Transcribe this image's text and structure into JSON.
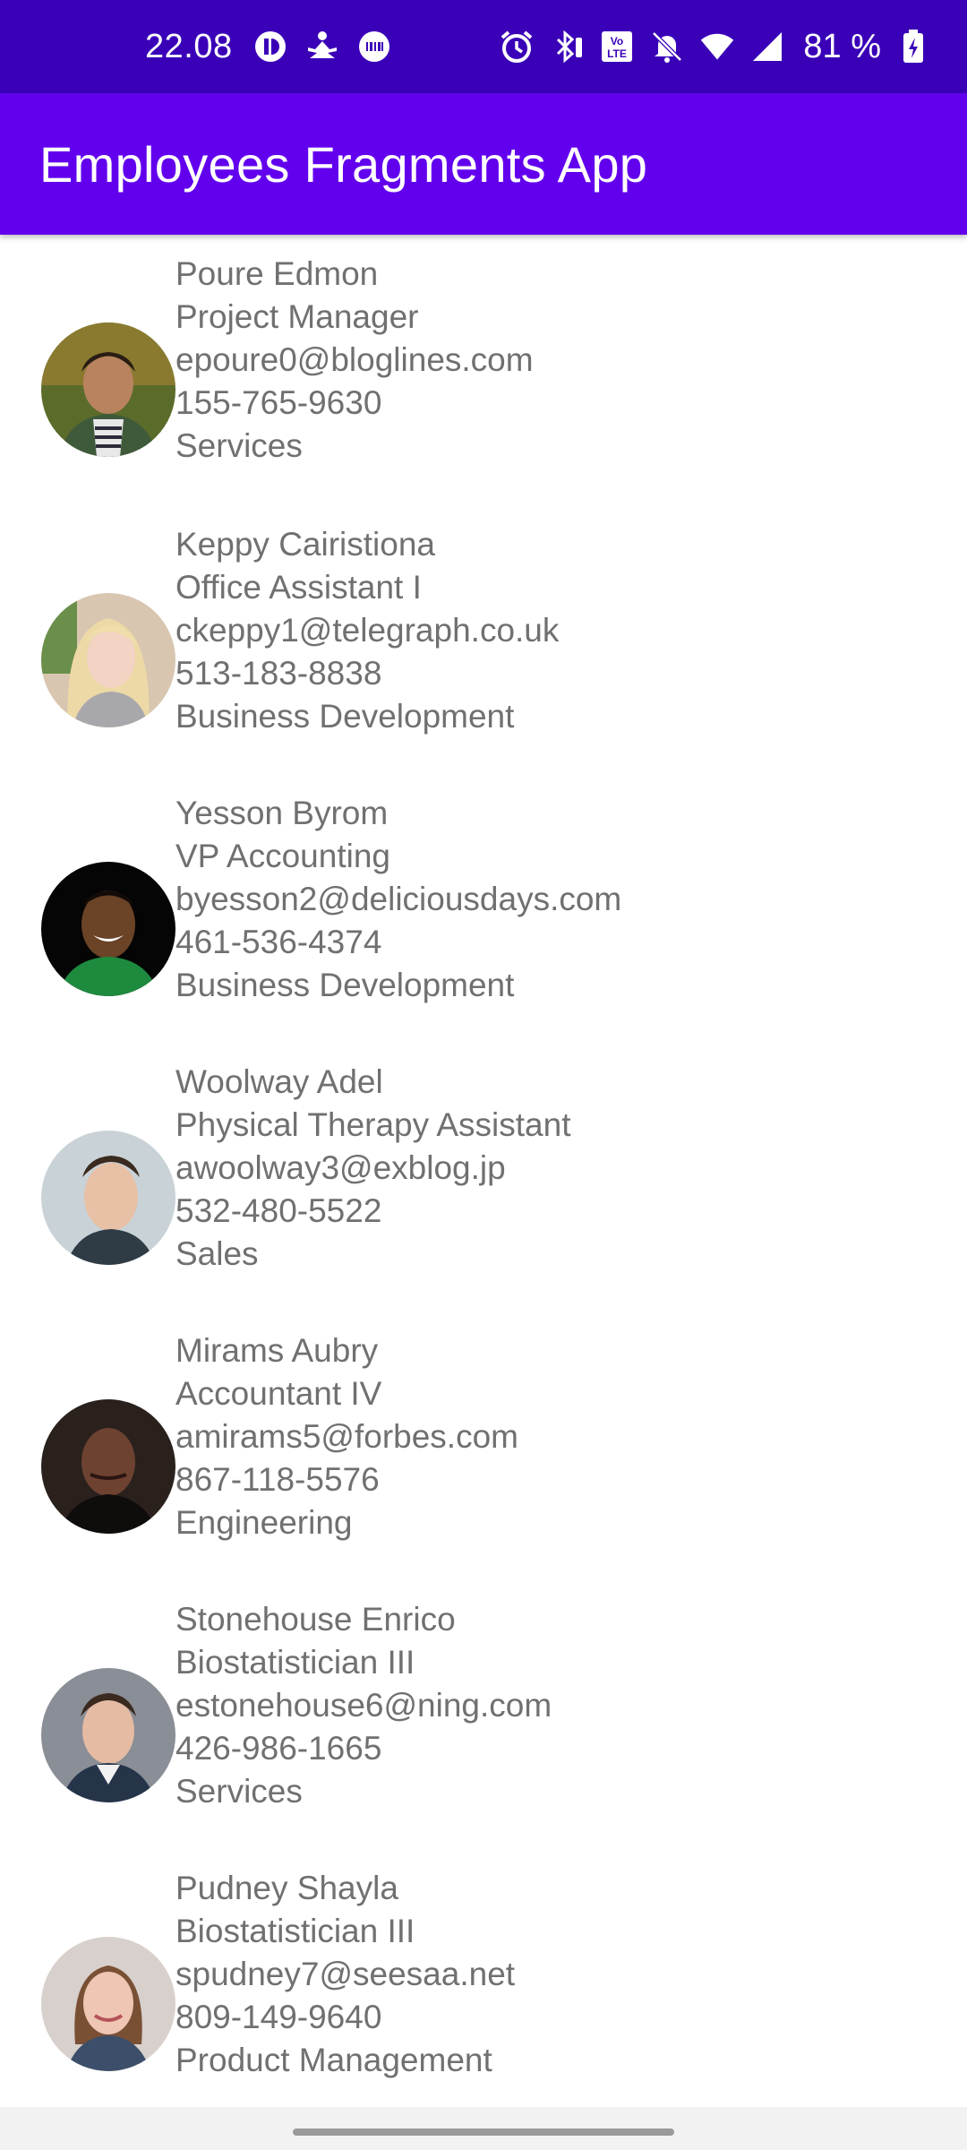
{
  "status_bar": {
    "time": "22.08",
    "left_icons": [
      "app-icon",
      "meditation-icon",
      "barcode-icon"
    ],
    "right_icons": [
      "alarm-icon",
      "bluetooth-icon",
      "volte-icon",
      "mute-icon",
      "wifi-icon",
      "signal-icon"
    ],
    "battery_text": "81 %"
  },
  "app_bar": {
    "title": "Employees Fragments App"
  },
  "colors": {
    "status_bar": "#3a00b8",
    "app_bar": "#6200ee",
    "text": "#707070"
  },
  "employees": [
    {
      "name": "Poure Edmon",
      "title": "Project Manager",
      "email": "epoure0@bloglines.com",
      "phone": "155-765-9630",
      "department": "Services"
    },
    {
      "name": "Keppy Cairistiona",
      "title": "Office Assistant I",
      "email": "ckeppy1@telegraph.co.uk",
      "phone": "513-183-8838",
      "department": "Business Development"
    },
    {
      "name": "Yesson Byrom",
      "title": "VP Accounting",
      "email": "byesson2@deliciousdays.com",
      "phone": "461-536-4374",
      "department": "Business Development"
    },
    {
      "name": "Woolway Adel",
      "title": "Physical Therapy Assistant",
      "email": "awoolway3@exblog.jp",
      "phone": "532-480-5522",
      "department": "Sales"
    },
    {
      "name": "Mirams Aubry",
      "title": "Accountant IV",
      "email": "amirams5@forbes.com",
      "phone": "867-118-5576",
      "department": "Engineering"
    },
    {
      "name": "Stonehouse Enrico",
      "title": "Biostatistician III",
      "email": "estonehouse6@ning.com",
      "phone": "426-986-1665",
      "department": "Services"
    },
    {
      "name": "Pudney Shayla",
      "title": "Biostatistician III",
      "email": "spudney7@seesaa.net",
      "phone": "809-149-9640",
      "department": "Product Management"
    }
  ]
}
